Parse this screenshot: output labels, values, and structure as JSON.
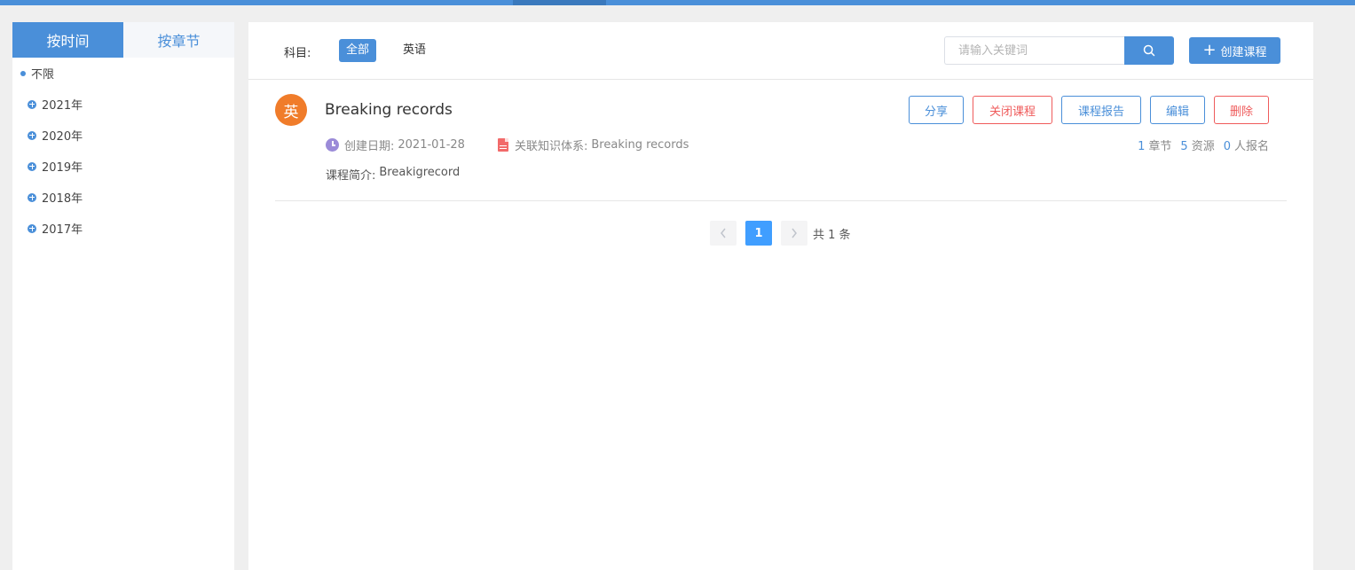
{
  "sidebar": {
    "tabs": [
      {
        "label": "按时间",
        "active": true
      },
      {
        "label": "按章节",
        "active": false
      }
    ],
    "unlimited_label": "不限",
    "years": [
      "2021年",
      "2020年",
      "2019年",
      "2018年",
      "2017年"
    ]
  },
  "filter": {
    "subject_label": "科目:",
    "subjects": [
      "全部",
      "英语"
    ],
    "search_placeholder": "请输入关键词",
    "create_label": "创建课程"
  },
  "course": {
    "avatar_char": "英",
    "title": "Breaking records",
    "date_label": "创建日期:",
    "date_value": "2021-01-28",
    "kb_label": "关联知识体系:",
    "kb_value": "Breaking records",
    "intro_label": "课程简介:",
    "intro_value": "Breakigrecord",
    "actions": [
      "分享",
      "关闭课程",
      "课程报告",
      "编辑",
      "删除"
    ],
    "stats": [
      {
        "num": "1",
        "label": "章节"
      },
      {
        "num": "5",
        "label": "资源"
      },
      {
        "num": "0",
        "label": "人报名"
      }
    ]
  },
  "pagination": {
    "current": "1",
    "total_text": "共 1 条"
  },
  "colors": {
    "primary": "#4a8fd9",
    "danger": "#ef5b5b",
    "avatar": "#f07c2a"
  }
}
